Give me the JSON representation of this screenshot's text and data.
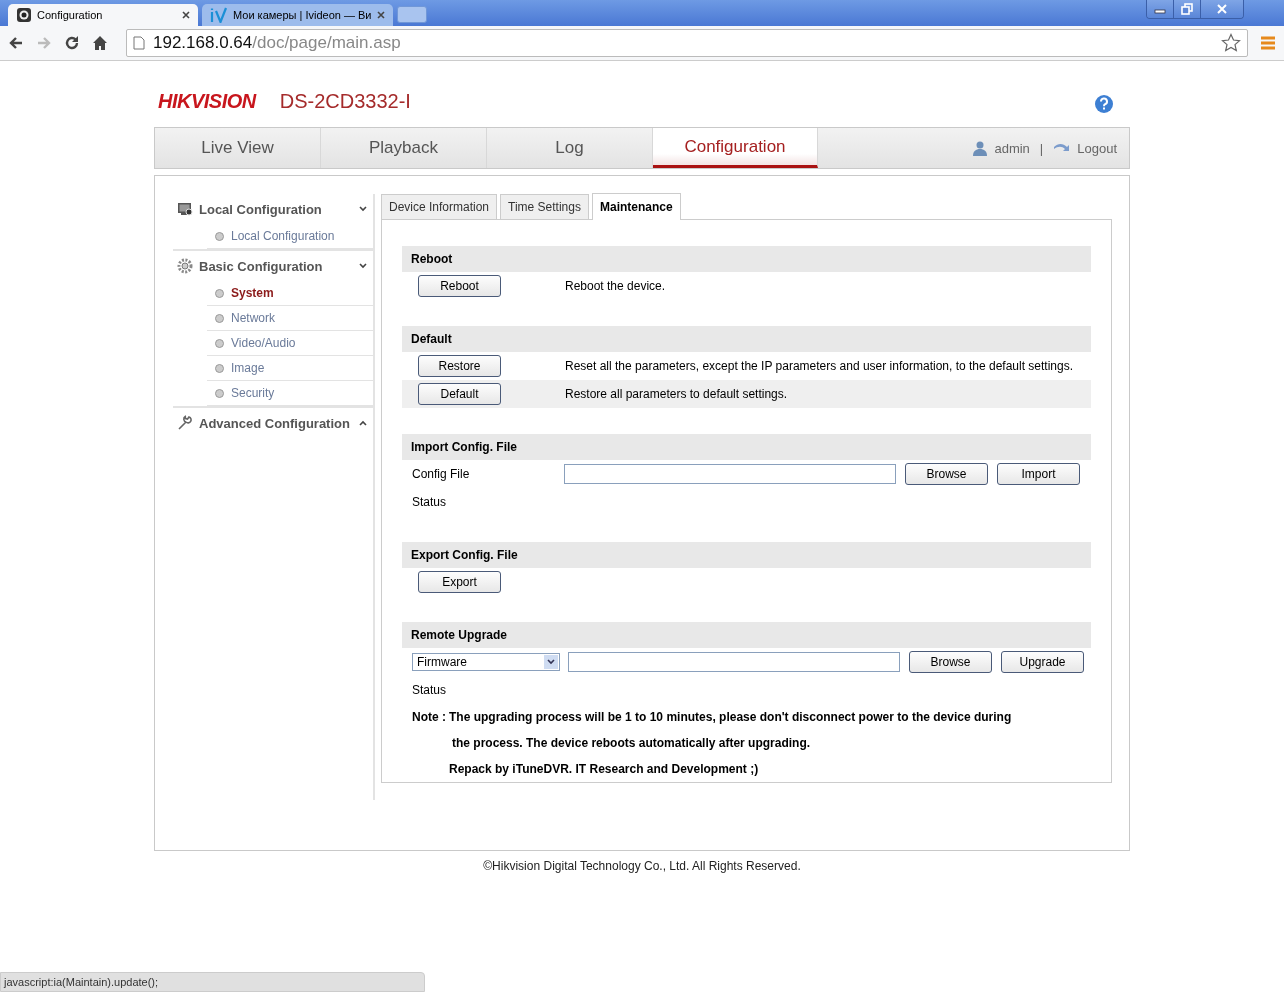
{
  "browser": {
    "tabs": [
      {
        "title": "Configuration",
        "selected": true,
        "kind": "camera"
      },
      {
        "title": "Мои камеры | Ivideon — Ви",
        "selected": false,
        "kind": "iv"
      }
    ],
    "address": {
      "host": "192.168.0.64",
      "path": "/doc/page/main.asp"
    }
  },
  "header": {
    "logo": "HIKVISION",
    "model": "DS-2CD3332-I"
  },
  "nav": {
    "items": [
      {
        "label": "Live View",
        "selected": false
      },
      {
        "label": "Playback",
        "selected": false
      },
      {
        "label": "Log",
        "selected": false
      },
      {
        "label": "Configuration",
        "selected": true
      }
    ],
    "user": "admin",
    "separator": "|",
    "logout": "Logout"
  },
  "sidebar": {
    "groups": [
      {
        "label": "Local Configuration",
        "kind": "monitor",
        "expanded": true,
        "children": [
          {
            "label": "Local Configuration",
            "selected": false
          }
        ]
      },
      {
        "label": "Basic Configuration",
        "kind": "gear",
        "expanded": true,
        "children": [
          {
            "label": "System",
            "selected": true
          },
          {
            "label": "Network",
            "selected": false
          },
          {
            "label": "Video/Audio",
            "selected": false
          },
          {
            "label": "Image",
            "selected": false
          },
          {
            "label": "Security",
            "selected": false
          }
        ]
      },
      {
        "label": "Advanced Configuration",
        "kind": "wrench",
        "expanded": false
      }
    ]
  },
  "tabs": [
    {
      "label": "Device Information",
      "selected": false
    },
    {
      "label": "Time Settings",
      "selected": false
    },
    {
      "label": "Maintenance",
      "selected": true
    }
  ],
  "sections": [
    {
      "title": "Reboot",
      "rows": [
        {
          "kind": "action",
          "button": "Reboot",
          "description": "Reboot the device.",
          "highlighted": false
        }
      ]
    },
    {
      "title": "Default",
      "rows": [
        {
          "kind": "action",
          "button": "Restore",
          "description": "Reset all the parameters, except the IP parameters and user information, to the default settings.",
          "highlighted": false
        },
        {
          "kind": "action",
          "button": "Default",
          "description": "Restore all parameters to default settings.",
          "highlighted": true
        }
      ]
    },
    {
      "title": "Import Config. File",
      "rows": [
        {
          "kind": "file",
          "label": "Config File",
          "buttons": [
            "Browse",
            "Import"
          ]
        },
        {
          "kind": "status",
          "label": "Status"
        }
      ]
    },
    {
      "title": "Export Config. File",
      "rows": [
        {
          "kind": "button",
          "button": "Export"
        }
      ]
    },
    {
      "title": "Remote Upgrade",
      "rows": [
        {
          "kind": "select-file",
          "select": "Firmware",
          "buttons": [
            "Browse",
            "Upgrade"
          ]
        },
        {
          "kind": "status",
          "label": "Status"
        },
        {
          "kind": "note",
          "label": "Note :",
          "lines": [
            "The upgrading process will be 1 to 10 minutes, please don't disconnect power to the device during",
            "the process. The device reboots automatically after upgrading.",
            "Repack by iTuneDVR. IT Research and Development ;)"
          ]
        }
      ]
    }
  ],
  "footer": "©Hikvision Digital Technology Co., Ltd. All Rights Reserved.",
  "status_bubble": "javascript:ia(Maintain).update();"
}
